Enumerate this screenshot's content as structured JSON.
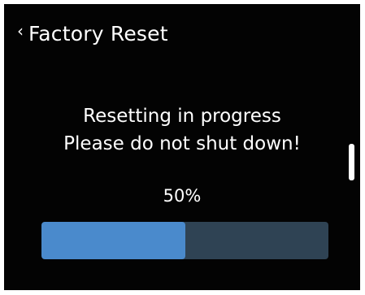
{
  "header": {
    "back_icon": "chevron-left-icon",
    "title": "Factory Reset"
  },
  "status": {
    "line1": "Resetting in progress",
    "line2": "Please do not shut down!"
  },
  "progress": {
    "percent_text": "50%",
    "value": 0.5,
    "fill_color": "#4a8acc",
    "track_color": "#2f4354"
  },
  "colors": {
    "background": "#030303",
    "text": "#ffffff"
  }
}
